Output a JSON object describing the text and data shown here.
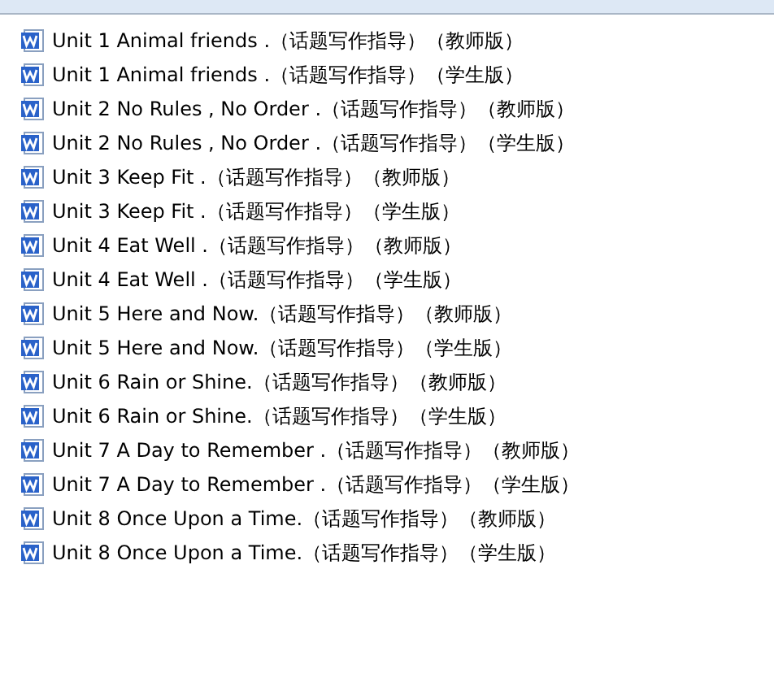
{
  "files": [
    {
      "name": "Unit 1 Animal friends .（话题写作指导）（教师版）"
    },
    {
      "name": "Unit 1 Animal friends .（话题写作指导）（学生版）"
    },
    {
      "name": "Unit 2 No Rules , No Order .（话题写作指导）（教师版）"
    },
    {
      "name": "Unit 2 No Rules , No Order .（话题写作指导）（学生版）"
    },
    {
      "name": "Unit 3 Keep Fit .（话题写作指导）（教师版）"
    },
    {
      "name": "Unit 3 Keep Fit .（话题写作指导）（学生版）"
    },
    {
      "name": "Unit 4 Eat Well .（话题写作指导）（教师版）"
    },
    {
      "name": "Unit 4 Eat Well .（话题写作指导）（学生版）"
    },
    {
      "name": "Unit 5 Here and Now.（话题写作指导）（教师版）"
    },
    {
      "name": "Unit 5 Here and Now.（话题写作指导）（学生版）"
    },
    {
      "name": "Unit 6 Rain or Shine.（话题写作指导）（教师版）"
    },
    {
      "name": "Unit 6 Rain or Shine.（话题写作指导）（学生版）"
    },
    {
      "name": "Unit 7 A Day to Remember .（话题写作指导）（教师版）"
    },
    {
      "name": "Unit 7 A Day to Remember .（话题写作指导）（学生版）"
    },
    {
      "name": "Unit 8 Once Upon a Time.（话题写作指导）（教师版）"
    },
    {
      "name": "Unit 8 Once Upon a Time.（话题写作指导）（学生版）"
    }
  ]
}
